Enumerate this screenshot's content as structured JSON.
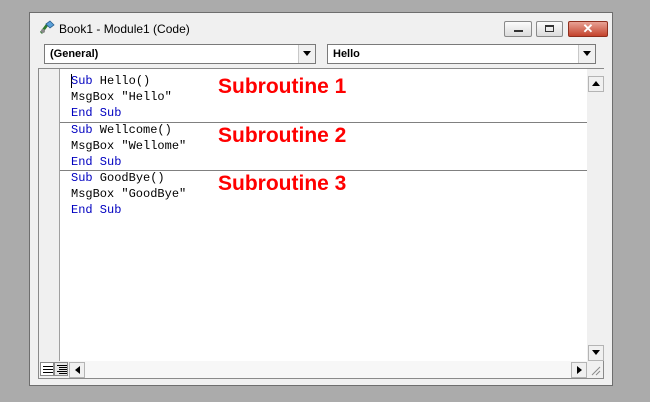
{
  "window": {
    "title": "Book1 - Module1 (Code)"
  },
  "toolbar": {
    "object_combo": "(General)",
    "procedure_combo": "Hello"
  },
  "code": {
    "lines": [
      {
        "keyword": "Sub",
        "rest": " Hello()"
      },
      {
        "keyword": "",
        "rest": "MsgBox \"Hello\""
      },
      {
        "keyword": "End Sub",
        "rest": ""
      },
      {
        "keyword": "Sub",
        "rest": " Wellcome()"
      },
      {
        "keyword": "",
        "rest": "MsgBox \"Wellome\""
      },
      {
        "keyword": "End Sub",
        "rest": ""
      },
      {
        "keyword": "Sub",
        "rest": " GoodBye()"
      },
      {
        "keyword": "",
        "rest": "MsgBox \"GoodBye\""
      },
      {
        "keyword": "End Sub",
        "rest": ""
      }
    ]
  },
  "annotations": {
    "sub1": "Subroutine 1",
    "sub2": "Subroutine 2",
    "sub3": "Subroutine 3"
  },
  "colors": {
    "keyword": "#0000c0",
    "annotation": "#ff0000",
    "close_button": "#c4432c"
  }
}
